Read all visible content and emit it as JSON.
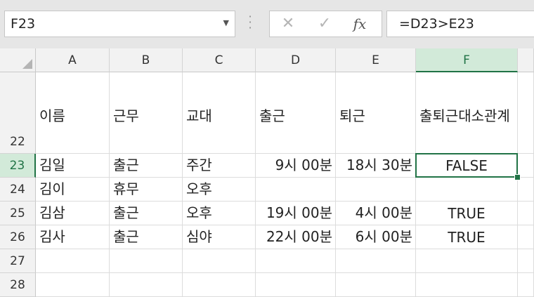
{
  "formula_bar": {
    "name_box": "F23",
    "cancel_icon": "✕",
    "enter_icon": "✓",
    "fx_label": "fx",
    "formula": "=D23>E23"
  },
  "columns": [
    "A",
    "B",
    "C",
    "D",
    "E",
    "F"
  ],
  "selected_column": "F",
  "rows": [
    {
      "num": "22",
      "cells": [
        "이름",
        "근무",
        "교대",
        "출근",
        "퇴근",
        "출퇴근대소관계"
      ]
    },
    {
      "num": "23",
      "cells": [
        "김일",
        "출근",
        "주간",
        "9시 00분",
        "18시 30분",
        "FALSE"
      ]
    },
    {
      "num": "24",
      "cells": [
        "김이",
        "휴무",
        "오후",
        "",
        "",
        ""
      ]
    },
    {
      "num": "25",
      "cells": [
        "김삼",
        "출근",
        "오후",
        "19시 00분",
        "4시 00분",
        "TRUE"
      ]
    },
    {
      "num": "26",
      "cells": [
        "김사",
        "출근",
        "심야",
        "22시 00분",
        "6시 00분",
        "TRUE"
      ]
    },
    {
      "num": "27",
      "cells": [
        "",
        "",
        "",
        "",
        "",
        ""
      ]
    },
    {
      "num": "28",
      "cells": [
        "",
        "",
        "",
        "",
        "",
        ""
      ]
    }
  ],
  "selected_cell": "F23",
  "colors": {
    "accent": "#217346",
    "header_selected_bg": "#d2ead9"
  }
}
